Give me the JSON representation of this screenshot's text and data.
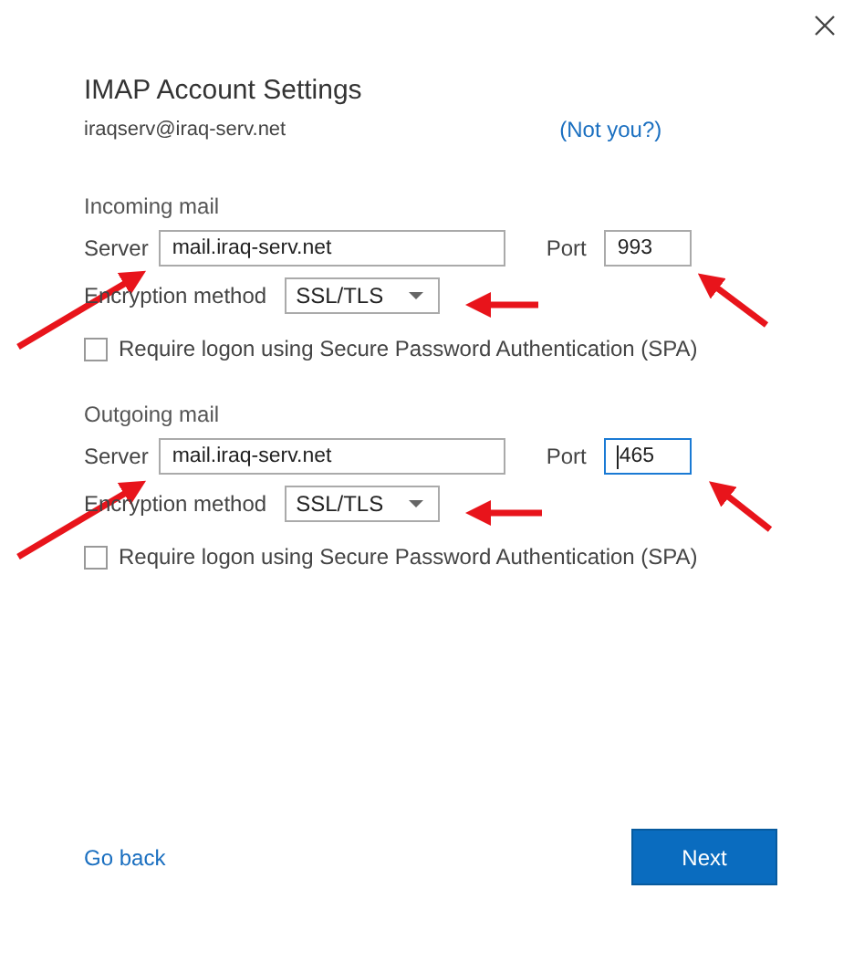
{
  "dialog": {
    "title": "IMAP Account Settings",
    "account": "iraqserv@iraq-serv.net",
    "not_you": "(Not you?)"
  },
  "sections": [
    {
      "heading": "Incoming mail",
      "server_label": "Server",
      "server": "mail.iraq-serv.net",
      "port_label": "Port",
      "port": "993",
      "port_focused": false,
      "encryption_label": "Encryption method",
      "encryption": "SSL/TLS",
      "spa": {
        "label": "Require logon using Secure Password Authentication (SPA)",
        "checked": false
      }
    },
    {
      "heading": "Outgoing mail",
      "server_label": "Server",
      "server": "mail.iraq-serv.net",
      "port_label": "Port",
      "port": "465",
      "port_focused": true,
      "encryption_label": "Encryption method",
      "encryption": "SSL/TLS",
      "spa": {
        "label": "Require logon using Secure Password Authentication (SPA)",
        "checked": false
      }
    }
  ],
  "footer": {
    "back": "Go back",
    "next": "Next"
  }
}
